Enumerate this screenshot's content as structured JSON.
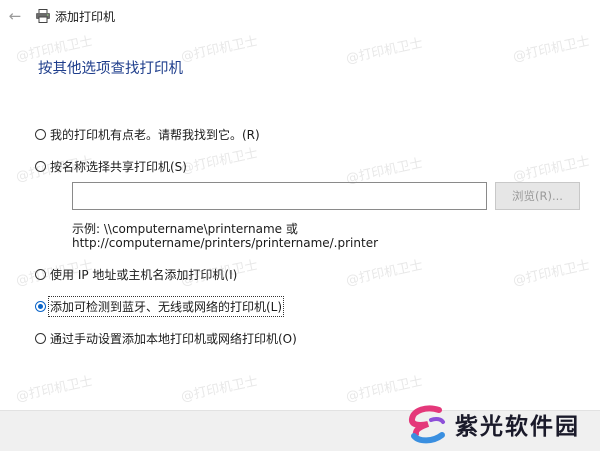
{
  "window": {
    "title": "添加打印机",
    "back_icon": "arrow-left-icon",
    "title_icon": "printer-icon"
  },
  "heading": "按其他选项查找打印机",
  "options": [
    {
      "label": "我的打印机有点老。请帮我找到它。(R)",
      "selected": false
    },
    {
      "label": "按名称选择共享打印机(S)",
      "selected": false
    },
    {
      "label": "使用 IP 地址或主机名添加打印机(I)",
      "selected": false
    },
    {
      "label": "添加可检测到蓝牙、无线或网络的打印机(L)",
      "selected": true
    },
    {
      "label": "通过手动设置添加本地打印机或网络打印机(O)",
      "selected": false
    }
  ],
  "shared_printer_name": {
    "value": "",
    "browse_label": "浏览(R)..."
  },
  "example": {
    "line1": "示例: \\\\computername\\printername 或",
    "line2": "http://computername/printers/printername/.printer"
  },
  "watermark_text": "@打印机卫士",
  "logo": {
    "text": "紫光软件园"
  },
  "colors": {
    "heading": "#1f3e8c",
    "radio_selected": "#0a64c8",
    "footer_bg": "#f0f0f0"
  }
}
